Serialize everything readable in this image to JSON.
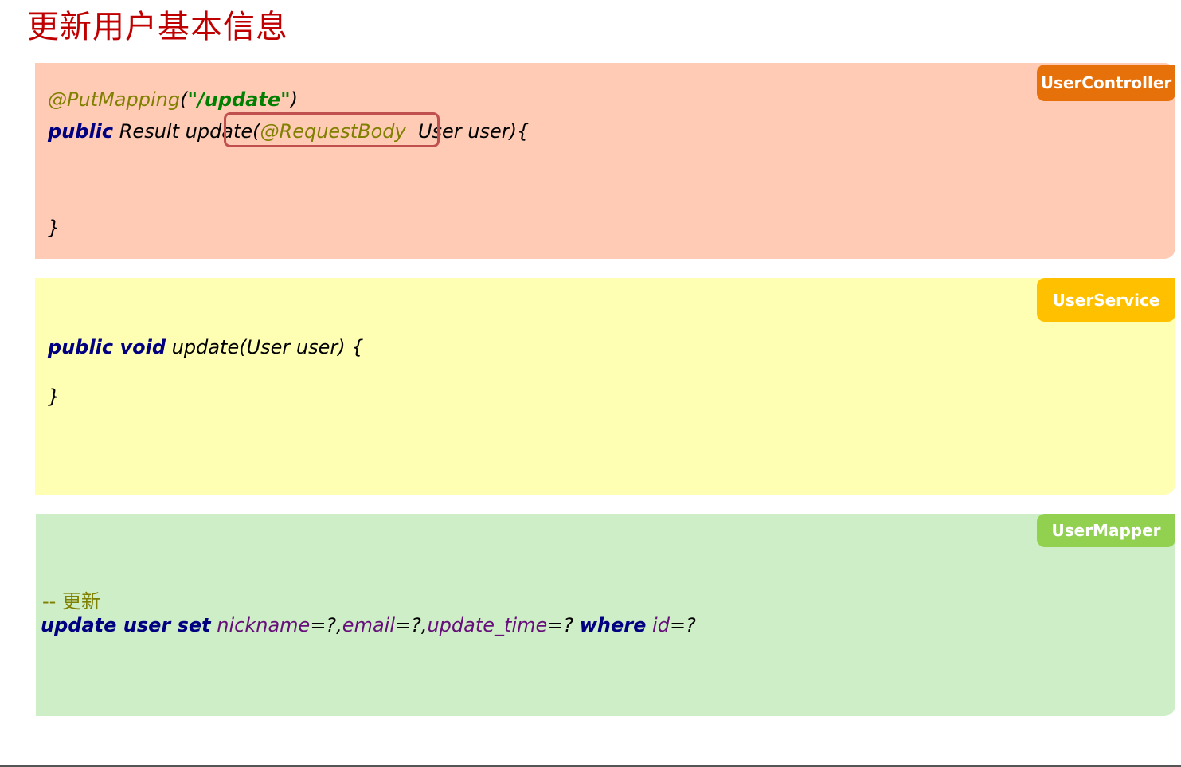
{
  "page": {
    "title": "更新用户基本信息"
  },
  "controller": {
    "tag": "UserController",
    "line1": {
      "annotation": "@PutMapping",
      "open": "(",
      "string": "\"/update\"",
      "close": ")"
    },
    "line2": {
      "kw": "public",
      "text1": " Result update(",
      "annotation": "@RequestBody",
      "text2": "  User user){"
    },
    "close_brace": "}"
  },
  "service": {
    "tag": "UserService",
    "line1": {
      "kw": "public void",
      "text": " update(User user) {"
    },
    "close_brace": "}"
  },
  "mapper": {
    "tag": "UserMapper",
    "comment": "-- 更新",
    "sql": {
      "kw1": "update user set",
      "f1": "nickname",
      "t1": "=?,",
      "f2": "email",
      "t2": "=?,",
      "f3": "update_time",
      "t3": "=? ",
      "kw2": "where",
      "f4": "id",
      "t4": "=?"
    }
  },
  "colors": {
    "title": "#c00000",
    "controller_bg": "#ffcbb5",
    "controller_tag": "#e6700a",
    "service_bg": "#ffffb3",
    "service_tag": "#ffc000",
    "mapper_bg": "#ceeec7",
    "mapper_tag": "#92d050",
    "highlight_border": "#c0504d"
  }
}
